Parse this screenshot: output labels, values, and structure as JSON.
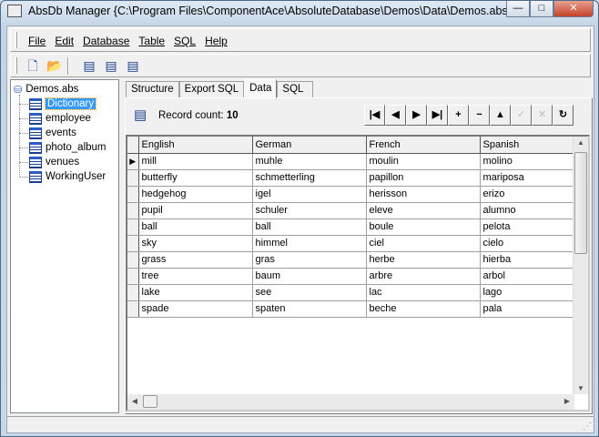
{
  "window": {
    "title": "AbsDb Manager {C:\\Program Files\\ComponentAce\\AbsoluteDatabase\\Demos\\Data\\Demos.abs}",
    "min": "—",
    "max": "□",
    "close": "✕"
  },
  "menu": [
    "File",
    "Edit",
    "Database",
    "Table",
    "SQL",
    "Help"
  ],
  "toolbar": [
    {
      "name": "new-icon",
      "glyph": "🗋"
    },
    {
      "name": "open-icon",
      "glyph": "📂"
    },
    {
      "name": "add-table-icon",
      "glyph": "▤"
    },
    {
      "name": "edit-table-icon",
      "glyph": "▤"
    },
    {
      "name": "delete-table-icon",
      "glyph": "▤"
    }
  ],
  "tree": {
    "root": "Demos.abs",
    "items": [
      "Dictionary",
      "employee",
      "events",
      "photo_album",
      "venues",
      "WorkingUser"
    ],
    "selected": "Dictionary"
  },
  "tabs": [
    "Structure",
    "Export SQL",
    "Data",
    "SQL"
  ],
  "active_tab": "Data",
  "record": {
    "label": "Record count:",
    "count": "10"
  },
  "nav": [
    {
      "name": "first",
      "g": "|◀"
    },
    {
      "name": "prior",
      "g": "◀"
    },
    {
      "name": "next",
      "g": "▶"
    },
    {
      "name": "last",
      "g": "▶|"
    },
    {
      "name": "insert",
      "g": "+"
    },
    {
      "name": "delete",
      "g": "−"
    },
    {
      "name": "edit",
      "g": "▲"
    },
    {
      "name": "post",
      "g": "✓",
      "disabled": true
    },
    {
      "name": "cancel",
      "g": "✕",
      "disabled": true
    },
    {
      "name": "refresh",
      "g": "↻"
    }
  ],
  "grid": {
    "columns": [
      "English",
      "German",
      "French",
      "Spanish"
    ],
    "rows": [
      [
        "mill",
        "muhle",
        "moulin",
        "molino"
      ],
      [
        "butterfly",
        "schmetterling",
        "papillon",
        "mariposa"
      ],
      [
        "hedgehog",
        "igel",
        "herisson",
        "erizo"
      ],
      [
        "pupil",
        "schuler",
        "eleve",
        "alumno"
      ],
      [
        "ball",
        "ball",
        "boule",
        "pelota"
      ],
      [
        "sky",
        "himmel",
        "ciel",
        "cielo"
      ],
      [
        "grass",
        "gras",
        "herbe",
        "hierba"
      ],
      [
        "tree",
        "baum",
        "arbre",
        "arbol"
      ],
      [
        "lake",
        "see",
        "lac",
        "lago"
      ],
      [
        "spade",
        "spaten",
        "beche",
        "pala"
      ]
    ],
    "current_row": 0
  }
}
